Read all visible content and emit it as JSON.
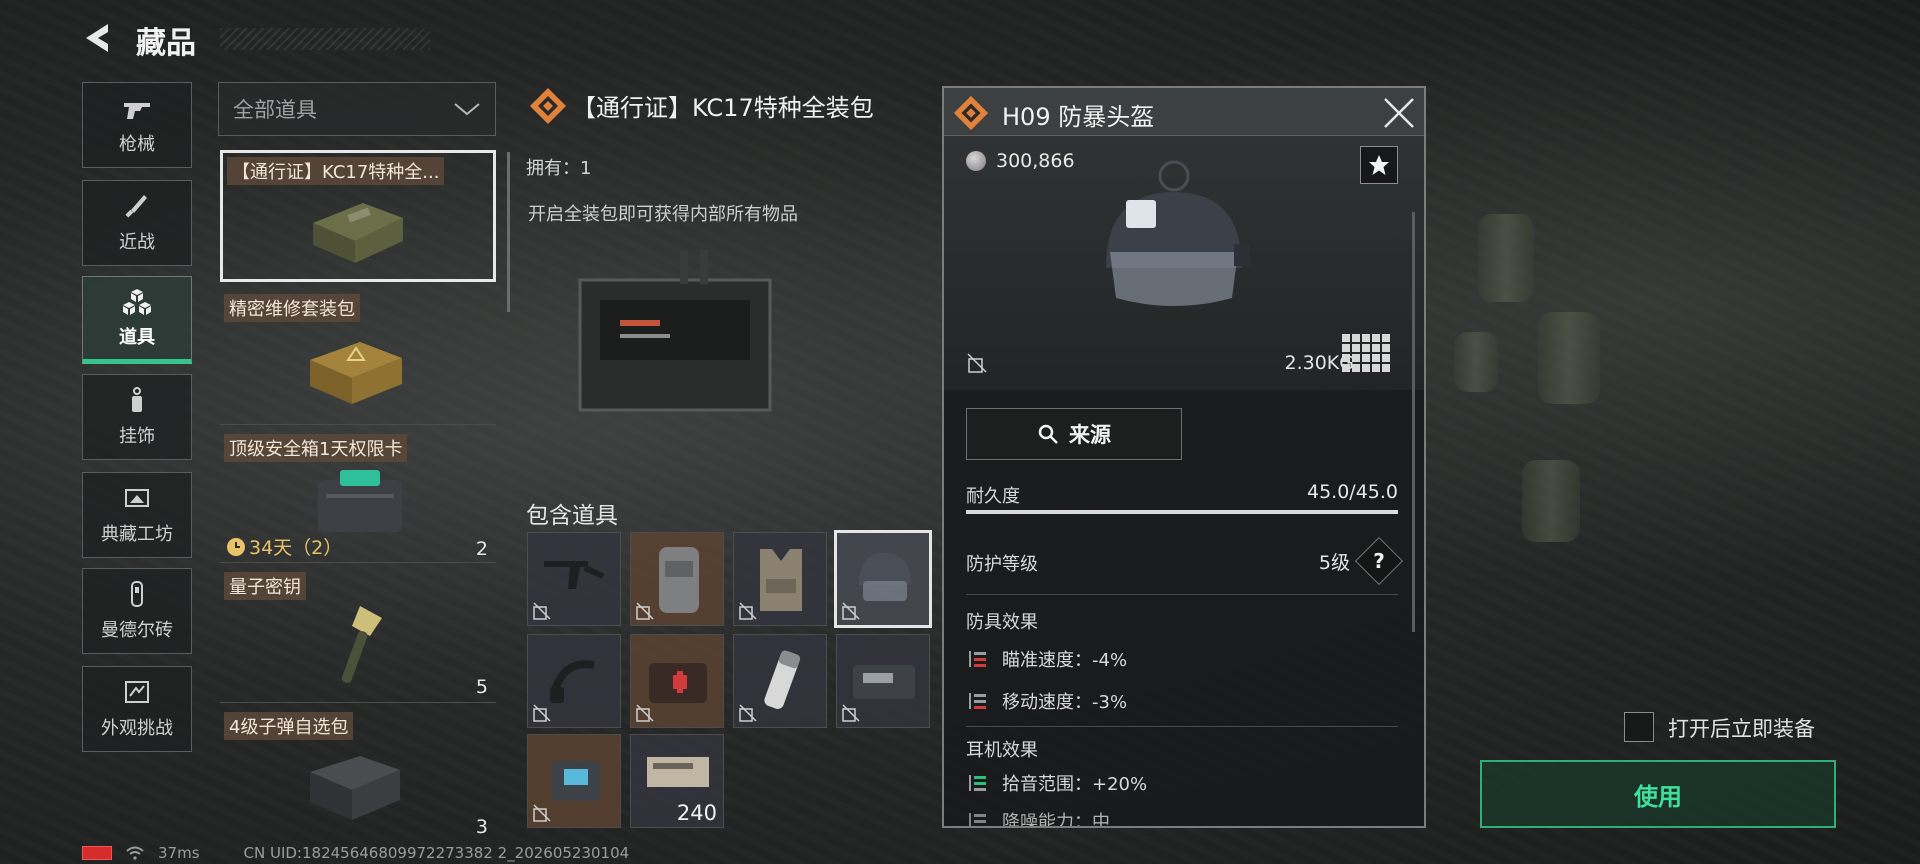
{
  "header": {
    "title": "藏品"
  },
  "categories": [
    {
      "label": "枪械",
      "icon": "gun-icon",
      "active": false
    },
    {
      "label": "近战",
      "icon": "knife-icon",
      "active": false
    },
    {
      "label": "道具",
      "icon": "cubes-icon",
      "active": true
    },
    {
      "label": "挂饰",
      "icon": "charm-icon",
      "active": false
    },
    {
      "label": "典藏工坊",
      "icon": "workshop-icon",
      "active": false
    },
    {
      "label": "曼德尔砖",
      "icon": "brick-icon",
      "active": false
    },
    {
      "label": "外观挑战",
      "icon": "challenge-icon",
      "active": false
    }
  ],
  "filter": {
    "selected": "全部道具"
  },
  "items": [
    {
      "name": "【通行证】KC17特种全...",
      "count": "",
      "timer": ""
    },
    {
      "name": "精密维修套装包",
      "count": "",
      "timer": ""
    },
    {
      "name": "顶级安全箱1天权限卡",
      "count": "2",
      "timer": "34天（2）"
    },
    {
      "name": "量子密钥",
      "count": "5",
      "timer": ""
    },
    {
      "name": "4级子弹自选包",
      "count": "3",
      "timer": ""
    }
  ],
  "detail": {
    "title": "【通行证】KC17特种全装包",
    "owned": "拥有：1",
    "description": "开启全装包即可获得内部所有物品",
    "contains_label": "包含道具",
    "slots": [
      {
        "icon": "smg-icon",
        "count": ""
      },
      {
        "icon": "backpack-icon",
        "count": ""
      },
      {
        "icon": "vest-icon",
        "count": ""
      },
      {
        "icon": "helmet-icon",
        "count": ""
      },
      {
        "icon": "headset-icon",
        "count": ""
      },
      {
        "icon": "medkit-icon",
        "count": ""
      },
      {
        "icon": "injector-icon",
        "count": ""
      },
      {
        "icon": "device-icon",
        "count": ""
      },
      {
        "icon": "container-icon",
        "count": ""
      },
      {
        "icon": "ammo-box-icon",
        "count": "240"
      }
    ]
  },
  "popup": {
    "title": "H09 防暴头盔",
    "price": "300,866",
    "weight": "2.30KG",
    "source_label": "来源",
    "durability_label": "耐久度",
    "durability_value": "45.0/45.0",
    "durability_fraction": 1.0,
    "protection_label": "防护等级",
    "protection_value": "5级",
    "armor_effects_label": "防具效果",
    "armor_effects": [
      {
        "text": "瞄准速度：-4%",
        "tone": "negative"
      },
      {
        "text": "移动速度：-3%",
        "tone": "negative"
      }
    ],
    "headset_effects_label": "耳机效果",
    "headset_effects": [
      {
        "text": "拾音范围：+20%",
        "tone": "positive"
      },
      {
        "text": "降噪能力：中",
        "tone": "neutral"
      }
    ]
  },
  "equip_on_open": {
    "label": "打开后立即装备",
    "checked": false
  },
  "use_button": {
    "label": "使用"
  },
  "status_bar": {
    "ping": "37ms",
    "uid": "CN UID:18245646809972273382 2_202605230104"
  },
  "colors": {
    "accent_green": "#37c48a",
    "tag_brown": "#5c483a",
    "negative": "#d33a3a",
    "positive": "#2fbf7a"
  }
}
